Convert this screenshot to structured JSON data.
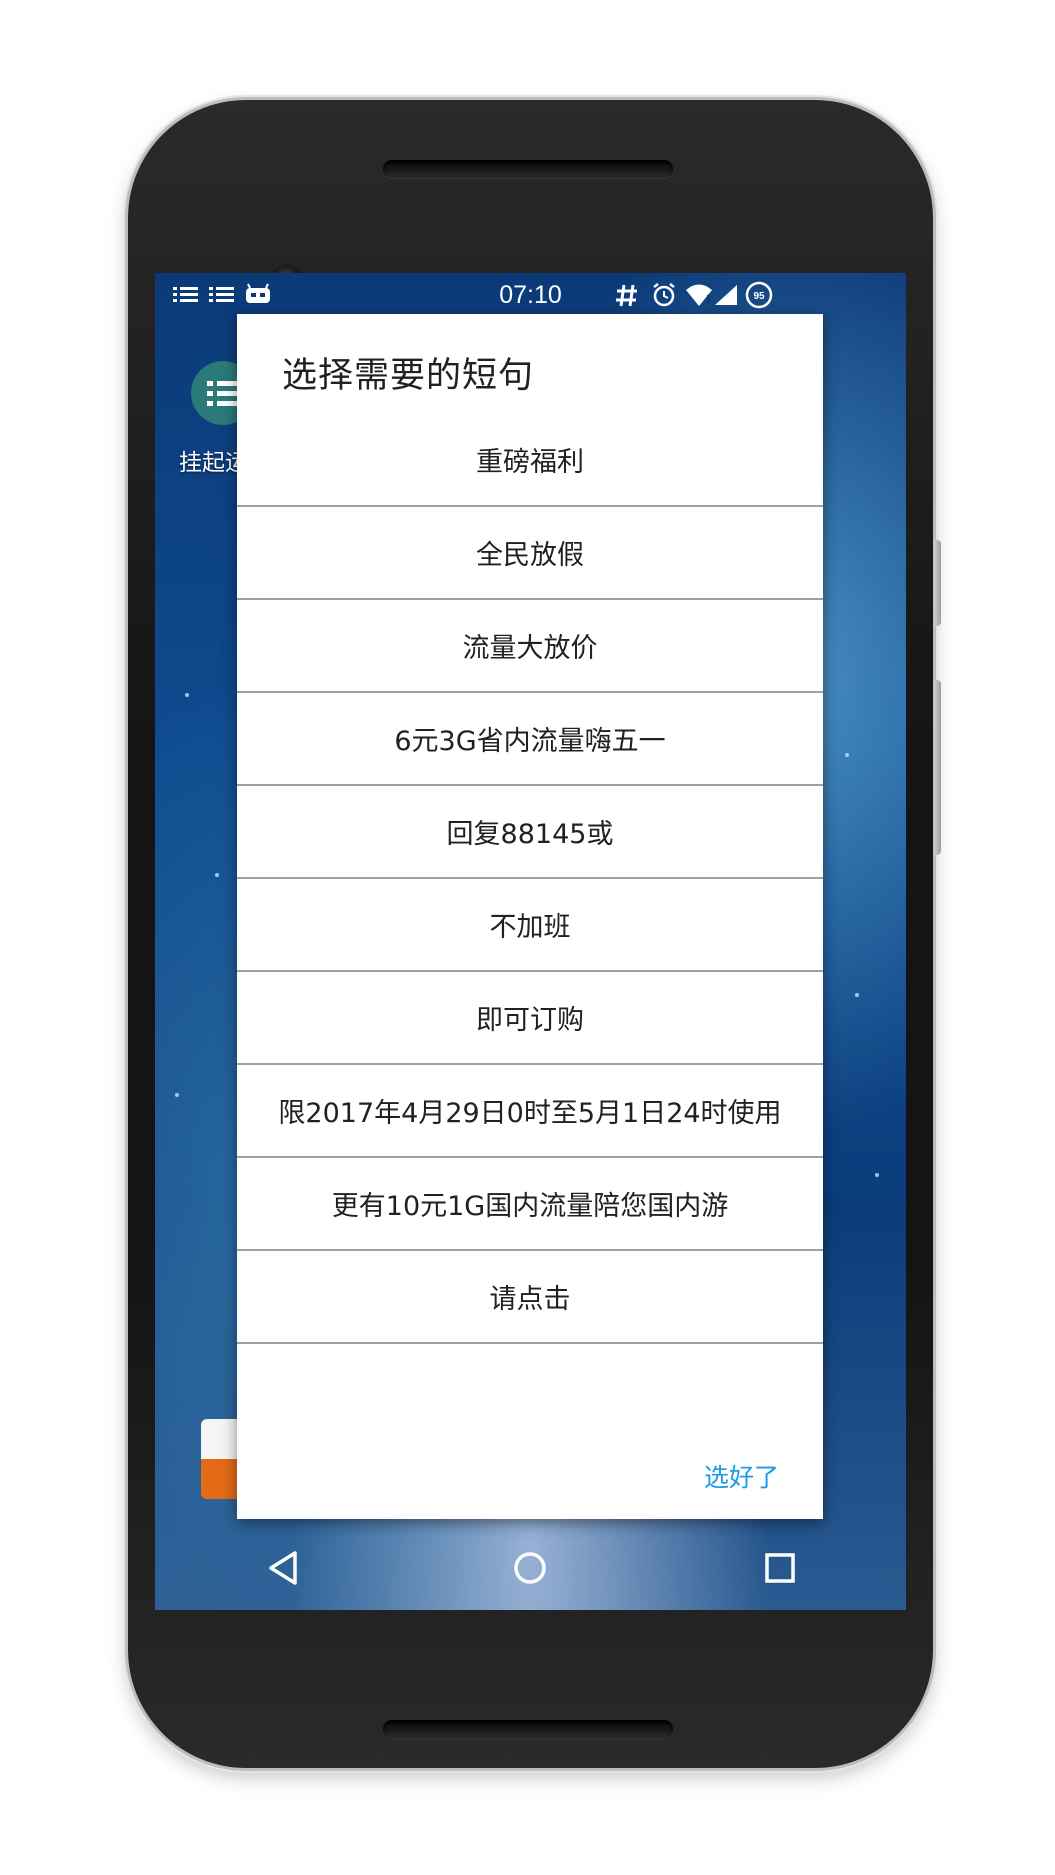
{
  "status_bar": {
    "time": "07:10",
    "icons_left": [
      "list-icon",
      "list-icon",
      "android-icon"
    ],
    "icons_right": [
      "hash-icon",
      "alarm-icon",
      "wifi-icon",
      "signal-icon",
      "battery-icon"
    ],
    "battery_level": "95"
  },
  "home_app": {
    "label": "挂起运"
  },
  "dialog": {
    "title": "选择需要的短句",
    "options": [
      "重磅福利",
      "全民放假",
      "流量大放价",
      "6元3G省内流量嗨五一",
      "回复88145或",
      "不加班",
      "即可订购",
      "限2017年4月29日0时至5月1日24时使用",
      "更有10元1G国内流量陪您国内游",
      "请点击"
    ],
    "confirm_label": "选好了"
  },
  "nav_bar": {
    "icons": [
      "back-icon",
      "home-icon",
      "recents-icon"
    ]
  },
  "colors": {
    "accent": "#1e9be8",
    "divider": "#a0a0a0",
    "text": "#212121"
  }
}
